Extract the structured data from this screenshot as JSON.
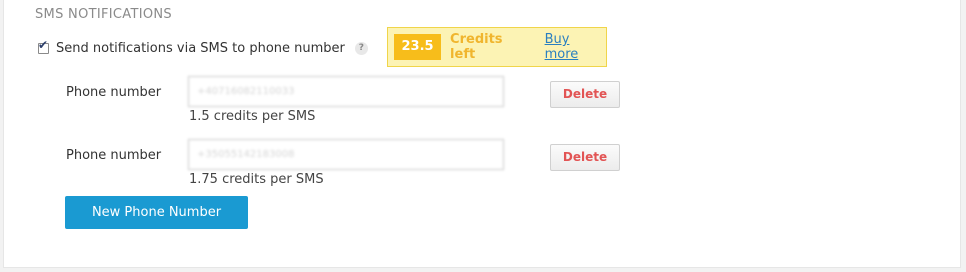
{
  "section": {
    "title": "SMS NOTIFICATIONS"
  },
  "sms_option": {
    "checked": true,
    "label": "Send notifications via SMS to phone number",
    "help_icon": "question-icon"
  },
  "credits": {
    "amount": "23.5",
    "label": "Credits left",
    "buy_more": "Buy more"
  },
  "phones": [
    {
      "label": "Phone number",
      "value": "+40716082110033",
      "credits_per_sms": "1.5 credits per SMS",
      "delete_label": "Delete"
    },
    {
      "label": "Phone number",
      "value": "+35055142183008",
      "credits_per_sms": "1.75 credits per SMS",
      "delete_label": "Delete"
    }
  ],
  "new_phone_button": "New Phone Number",
  "colors": {
    "credits_badge": "#f7bd1b",
    "credits_box_bg": "#fcf3b4",
    "delete_text": "#e25454",
    "primary_button": "#1a9ad2",
    "link": "#2a7fc0"
  }
}
